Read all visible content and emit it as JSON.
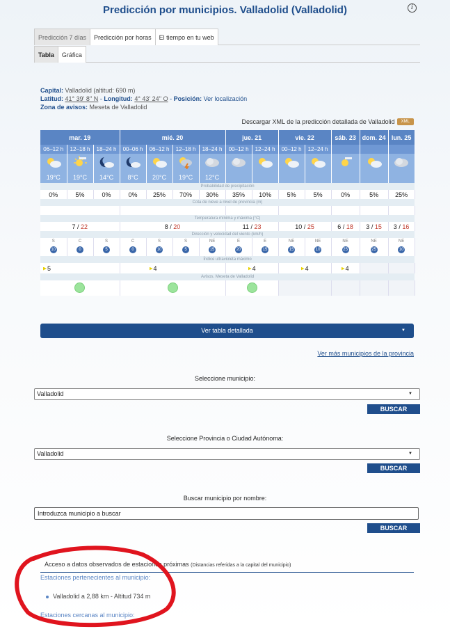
{
  "title": "Predicción por municipios. Valladolid (Valladolid)",
  "info_icon": "info-icon",
  "tabs_primary": [
    "Predicción 7 días",
    "Predicción por horas",
    "El tiempo en tu web"
  ],
  "tabs_secondary": [
    "Tabla",
    "Gráfica"
  ],
  "capital": {
    "capital_label": "Capital:",
    "capital_value": "Valladolid (altitud: 690 m)",
    "lat_label": "Latitud:",
    "lat_value": "41° 39' 8'' N",
    "lon_label": "Longitud:",
    "lon_value": "4° 43' 24'' O",
    "pos_label": "Posición:",
    "pos_link": "Ver localización",
    "zona_label": "Zona de avisos:",
    "zona_value": "Meseta de Valladolid"
  },
  "xml": {
    "text": "Descargar XML de la predicción detallada de Valladolid",
    "badge": "XML"
  },
  "forecast": {
    "days": [
      "mar. 19",
      "mié. 20",
      "jue. 21",
      "vie. 22",
      "sáb. 23",
      "dom. 24",
      "lun. 25"
    ],
    "periods": [
      "06–12 h",
      "12–18 h",
      "18–24 h",
      "00–06 h",
      "06–12 h",
      "12–18 h",
      "18–24 h",
      "00–12 h",
      "12–24 h",
      "00–12 h",
      "12–24 h"
    ],
    "temps": [
      "19°C",
      "19°C",
      "14°C",
      "8°C",
      "20°C",
      "19°C",
      "12°C"
    ],
    "label_precip": "Probabilidad de precipitación",
    "precip": [
      "0%",
      "5%",
      "0%",
      "0%",
      "25%",
      "70%",
      "30%",
      "35%",
      "10%",
      "5%",
      "5%",
      "0%",
      "5%",
      "25%"
    ],
    "label_nieve": "Cota de nieve a nivel de provincia (m)",
    "label_temp": "Temperatura mínima y máxima (°C)",
    "tmin": [
      "7",
      "8",
      "11",
      "10",
      "6",
      "3",
      "3"
    ],
    "tmax": [
      "22",
      "20",
      "23",
      "25",
      "18",
      "15",
      "16"
    ],
    "label_viento": "Dirección y velocidad del viento (km/h)",
    "wind_dir": [
      "S",
      "C",
      "S",
      "C",
      "S",
      "S",
      "NE",
      "E",
      "E",
      "NE",
      "NE",
      "NE",
      "NE",
      "NE"
    ],
    "wind_speed": [
      "10",
      "0",
      "5",
      "0",
      "10",
      "5",
      "15",
      "20",
      "15",
      "15",
      "10",
      "25",
      "25",
      "10"
    ],
    "label_uv": "Índice ultravioleta máximo",
    "uv": [
      "5",
      "4",
      "4",
      "4",
      "4"
    ],
    "label_avisos": "Avisos. Meseta de Valladolid"
  },
  "detail_button": "Ver tabla detallada",
  "more_link": "Ver más municipios de la provincia",
  "sel_municipio": {
    "label": "Seleccione municipio:",
    "value": "Valladolid",
    "button": "BUSCAR"
  },
  "sel_provincia": {
    "label": "Seleccione Provincia o Ciudad Autónoma:",
    "value": "Valladolid",
    "button": "BUSCAR"
  },
  "buscar_nombre": {
    "label": "Buscar municipio por nombre:",
    "placeholder": "Introduzca municipio a buscar",
    "button": "BUSCAR"
  },
  "observados": {
    "title": "Acceso a datos observados de estaciones próximas",
    "subtitle": "(Distancias referidas a la capital del municipio)",
    "pertenecientes": "Estaciones pertenecientes al municipio:",
    "item": "Valladolid a 2,88 km - Altitud 734 m",
    "cercanas": "Estaciones cercanas al municipio:"
  }
}
